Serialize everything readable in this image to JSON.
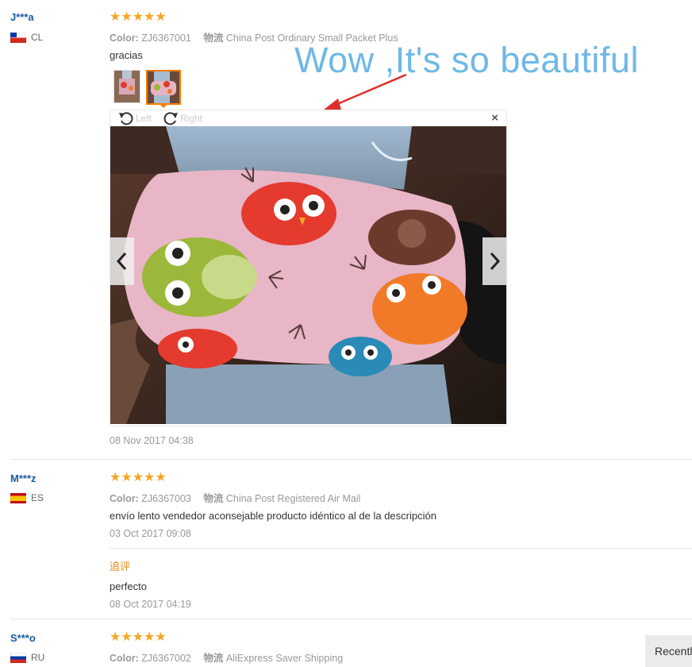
{
  "reviews": [
    {
      "user": "J***a",
      "country": "CL",
      "rating": "★★★★★",
      "color_label": "Color:",
      "color_value": "ZJ6367001",
      "shipping_label": "物流",
      "shipping_value": "China Post Ordinary Small Packet Plus",
      "text": "gracias",
      "date": "08 Nov 2017 04:38"
    },
    {
      "user": "M***z",
      "country": "ES",
      "rating": "★★★★★",
      "color_label": "Color:",
      "color_value": "ZJ6367003",
      "shipping_label": "物流",
      "shipping_value": "China Post Registered Air Mail",
      "text": "envío lento vendedor aconsejable producto idéntico al de la descripción",
      "date": "03 Oct 2017 09:08",
      "followup_label": "追评",
      "followup_text": "perfecto",
      "followup_date": "08 Oct 2017 04:19"
    },
    {
      "user": "S***o",
      "country": "RU",
      "rating": "★★★★★",
      "color_label": "Color:",
      "color_value": "ZJ6367002",
      "shipping_label": "物流",
      "shipping_value": "AliExpress Saver Shipping"
    }
  ],
  "viewer": {
    "rotate_left": "Left",
    "rotate_right": "Right",
    "close": "×"
  },
  "overlay": {
    "text": "Wow ,It's so beautiful",
    "color": "#6db8e8",
    "arrow_color": "#e0302c"
  },
  "recent_button": "Recently",
  "colors": {
    "star": "#f5a623",
    "username": "#1a5a9e",
    "followup": "#e8870e",
    "active_thumb": "#ff7a00"
  }
}
